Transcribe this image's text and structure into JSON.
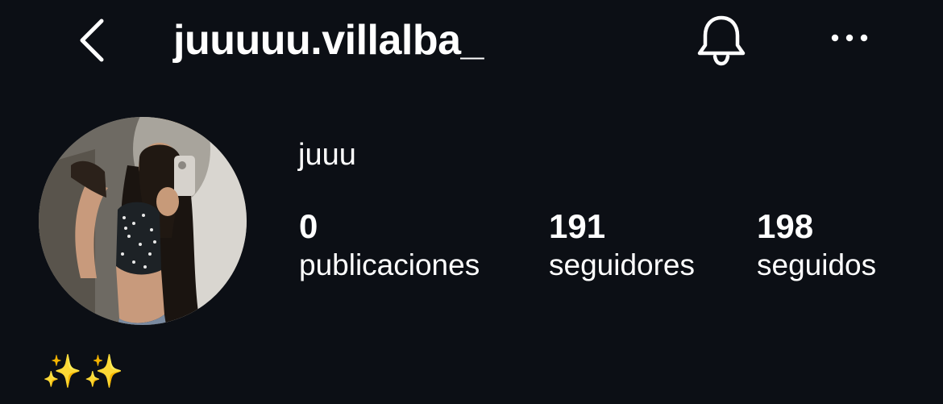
{
  "header": {
    "back_icon": "chevron-left-icon",
    "username": "juuuuu.villalba_",
    "bell_icon": "bell-icon",
    "more_icon": "more-horizontal-icon"
  },
  "profile": {
    "avatar": "profile-photo",
    "display_name": "juuu",
    "stats": [
      {
        "value": "0",
        "label": "publicaciones"
      },
      {
        "value": "191",
        "label": "seguidores"
      },
      {
        "value": "198",
        "label": "seguidos"
      }
    ],
    "bio": "✨✨"
  },
  "colors": {
    "background": "#0c0f15",
    "text": "#ffffff",
    "sparkle": "#f4c542"
  }
}
